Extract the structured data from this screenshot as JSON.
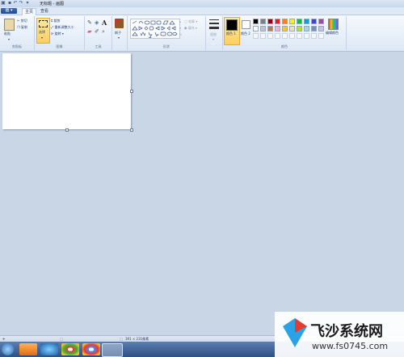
{
  "window": {
    "title": "无标题 - 画图"
  },
  "tabs": {
    "file": "画",
    "home": "主页",
    "view": "查看"
  },
  "clipboard": {
    "paste": "粘贴",
    "cut": "剪切",
    "copy": "复制",
    "label": "剪贴板"
  },
  "image": {
    "select": "选择",
    "crop": "裁剪",
    "resize": "重新调整大小",
    "rotate": "旋转",
    "label": "图像"
  },
  "tools": {
    "label": "工具"
  },
  "brushes": {
    "label": "刷子"
  },
  "shapes": {
    "outline": "轮廓",
    "fill": "填充",
    "label": "形状"
  },
  "size": {
    "label": "粗细"
  },
  "colors": {
    "color1": "颜色 1",
    "color2": "颜色 2",
    "edit": "编辑颜色",
    "label": "颜色",
    "palette_row1": [
      "#000000",
      "#7f7f7f",
      "#880015",
      "#ed1c24",
      "#ff7f27",
      "#fff200",
      "#22b14c",
      "#00a2e8",
      "#3f48cc",
      "#a349a4"
    ],
    "palette_row2": [
      "#ffffff",
      "#c3c3c3",
      "#b97a57",
      "#ffaec9",
      "#ffc90e",
      "#efe4b0",
      "#b5e61d",
      "#99d9ea",
      "#7092be",
      "#c8bfe7"
    ]
  },
  "status": {
    "dimensions": "391 × 231像素"
  },
  "watermark": {
    "title": "飞沙系统网",
    "url": "www.fs0745.com"
  }
}
